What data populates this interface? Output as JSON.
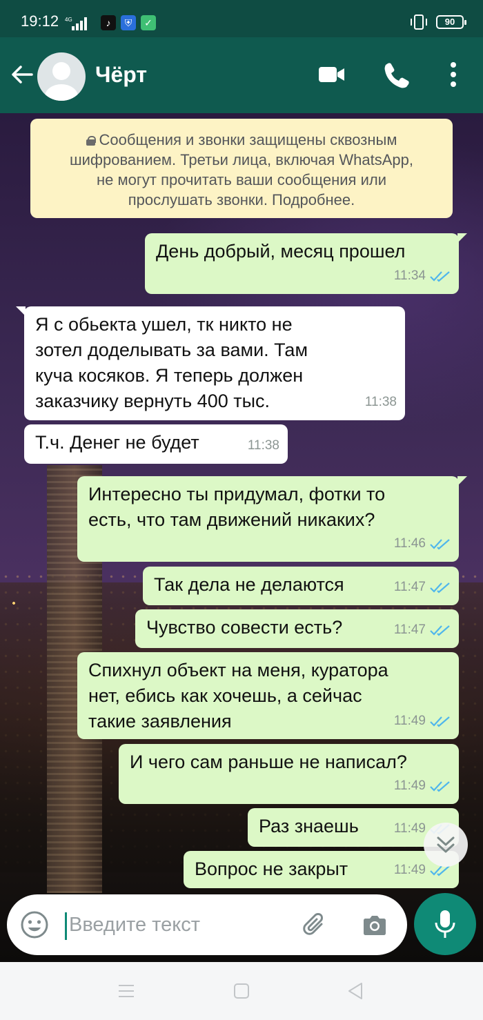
{
  "status_bar": {
    "time": "19:12",
    "network": "4G",
    "battery": "90"
  },
  "header": {
    "contact_name": "Чёрт"
  },
  "encryption_notice": {
    "line1": "Сообщения и звонки защищены сквозным",
    "line2": "шифрованием. Третьи лица, включая WhatsApp,",
    "line3": "не могут прочитать ваши сообщения или",
    "line4": "прослушать звонки. Подробнее."
  },
  "messages": [
    {
      "direction": "out",
      "lines": [
        "День добрый, месяц прошел"
      ],
      "time": "11:34",
      "read": true
    },
    {
      "direction": "in",
      "lines": [
        "Я с обьекта ушел, тк никто не",
        "зотел доделывать за вами. Там",
        "куча косяков. Я теперь должен",
        "заказчику вернуть 400 тыс."
      ],
      "time": "11:38"
    },
    {
      "direction": "in",
      "lines": [
        "Т.ч. Денег не будет"
      ],
      "time": "11:38"
    },
    {
      "direction": "out",
      "lines": [
        "Интересно ты придумал, фотки то",
        "есть, что там движений никаких?"
      ],
      "time": "11:46",
      "read": true
    },
    {
      "direction": "out",
      "lines": [
        "Так дела не делаются"
      ],
      "time": "11:47",
      "read": true
    },
    {
      "direction": "out",
      "lines": [
        "Чувство совести есть?"
      ],
      "time": "11:47",
      "read": true
    },
    {
      "direction": "out",
      "lines": [
        "Спихнул объект на меня, куратора",
        "нет, ебись как хочешь, а сейчас",
        "такие заявления"
      ],
      "time": "11:49",
      "read": true
    },
    {
      "direction": "out",
      "lines": [
        "И чего сам раньше не написал?"
      ],
      "time": "11:49",
      "read": true
    },
    {
      "direction": "out",
      "lines": [
        "Раз знаешь"
      ],
      "time": "11:49",
      "read": true
    },
    {
      "direction": "out",
      "lines": [
        "Вопрос не закрыт"
      ],
      "time": "11:49",
      "read": true
    }
  ],
  "composer": {
    "placeholder": "Введите текст"
  },
  "colors": {
    "header": "#0f5a4f",
    "outgoing_bubble": "#dcf8c6",
    "incoming_bubble": "#ffffff",
    "read_ticks": "#4fb6ec",
    "mic_button": "#0f8a76"
  },
  "icons": {
    "back": "arrow-left-icon",
    "video": "video-call-icon",
    "phone": "phone-icon",
    "menu": "more-vertical-icon",
    "emoji": "emoji-icon",
    "attach": "paperclip-icon",
    "camera": "camera-icon",
    "mic": "microphone-icon",
    "scroll": "chevron-double-down-icon"
  }
}
